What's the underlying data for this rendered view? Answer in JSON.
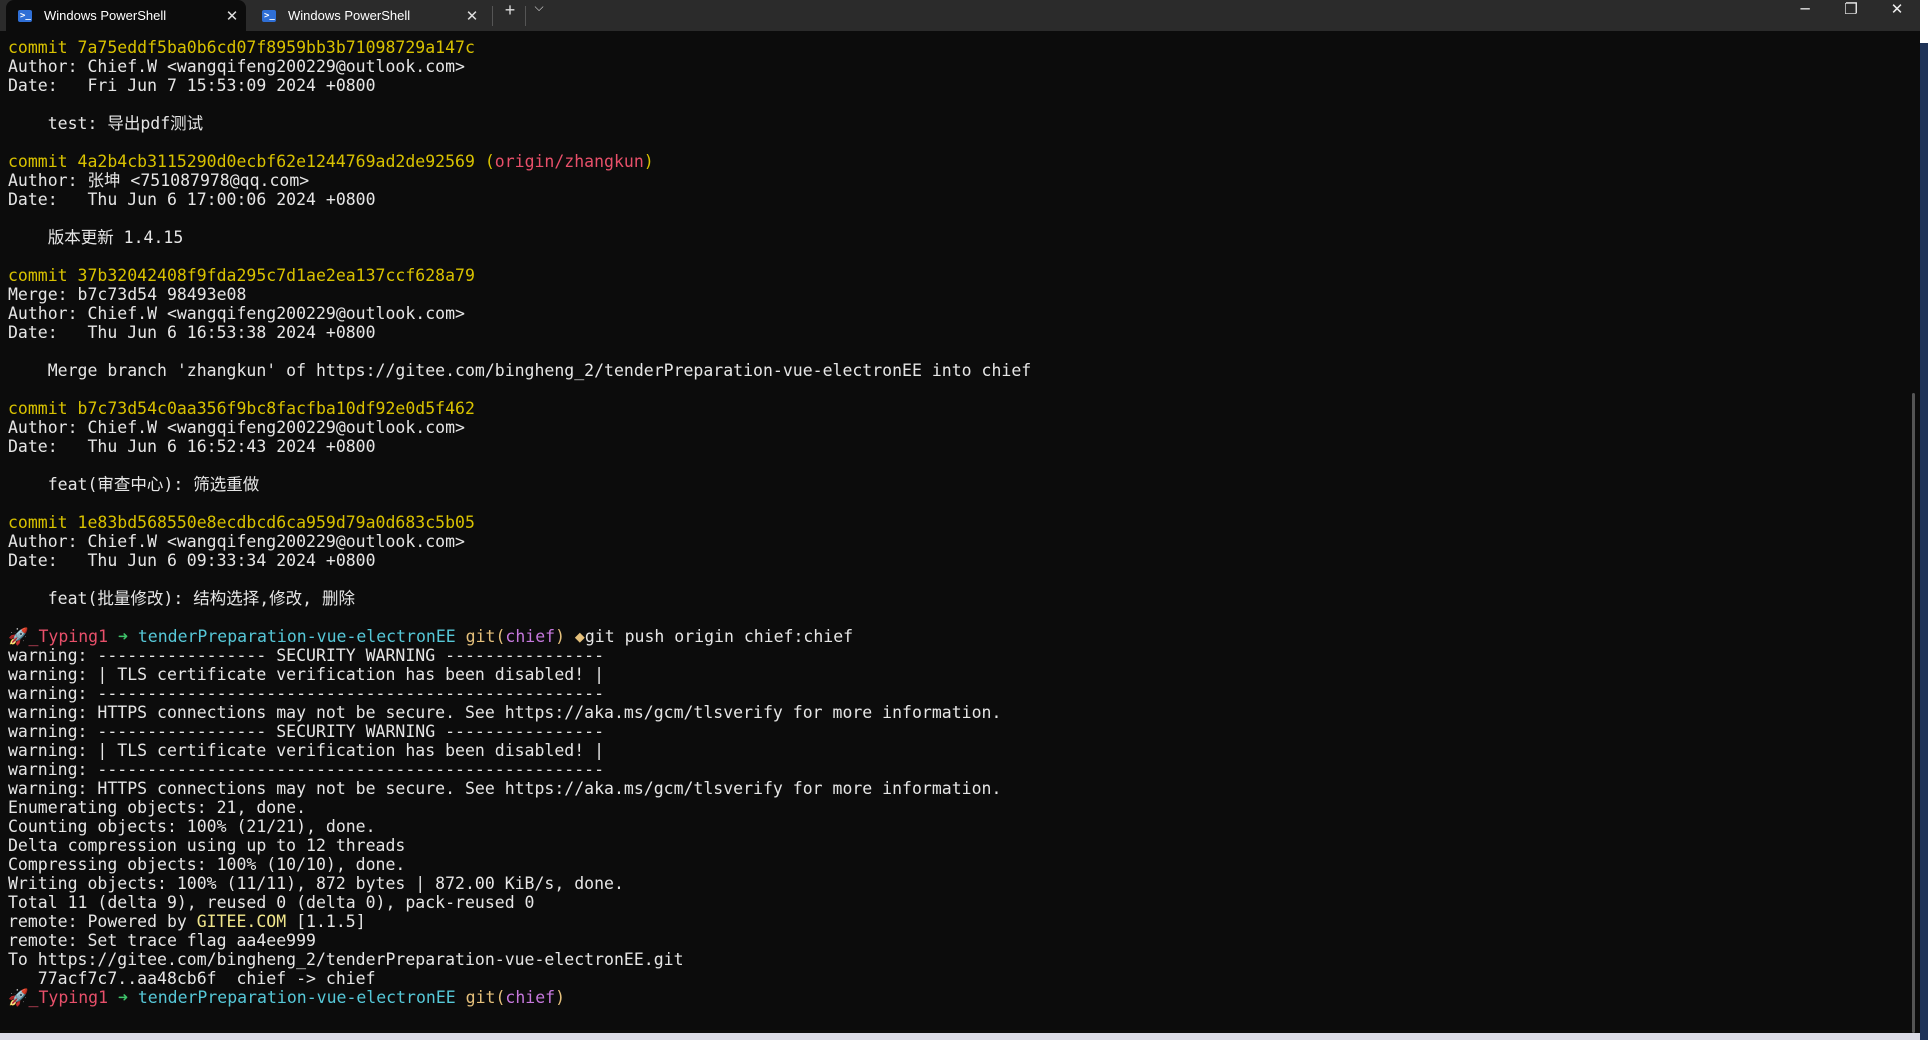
{
  "tabs": [
    {
      "label": "Windows PowerShell",
      "active": true
    },
    {
      "label": "Windows PowerShell",
      "active": false
    }
  ],
  "colors": {
    "commit": "#d9c200",
    "branch": "#e8506a",
    "text": "#e6e6e6",
    "cyan": "#56c8d8",
    "gitparen": "#e5c07b",
    "branchname": "#c678dd",
    "arrow": "#3fc56b",
    "gitee": "#f0e68c",
    "user": "#e8506a"
  },
  "lines": [
    [
      {
        "t": "commit 7a75eddf5ba0b6cd07f8959bb3b71098729a147c",
        "c": "commit"
      }
    ],
    [
      {
        "t": "Author: Chief.W <wangqifeng200229@outlook.com>"
      }
    ],
    [
      {
        "t": "Date:   Fri Jun 7 15:53:09 2024 +0800"
      }
    ],
    [],
    [
      {
        "t": "    test: 导出pdf测试"
      }
    ],
    [],
    [
      {
        "t": "commit 4a2b4cb3115290d0ecbf62e1244769ad2de92569 (",
        "c": "commit"
      },
      {
        "t": "origin/zhangkun",
        "c": "branch"
      },
      {
        "t": ")",
        "c": "commit"
      }
    ],
    [
      {
        "t": "Author: 张坤 <751087978@qq.com>"
      }
    ],
    [
      {
        "t": "Date:   Thu Jun 6 17:00:06 2024 +0800"
      }
    ],
    [],
    [
      {
        "t": "    版本更新 1.4.15"
      }
    ],
    [],
    [
      {
        "t": "commit 37b32042408f9fda295c7d1ae2ea137ccf628a79",
        "c": "commit"
      }
    ],
    [
      {
        "t": "Merge: b7c73d54 98493e08"
      }
    ],
    [
      {
        "t": "Author: Chief.W <wangqifeng200229@outlook.com>"
      }
    ],
    [
      {
        "t": "Date:   Thu Jun 6 16:53:38 2024 +0800"
      }
    ],
    [],
    [
      {
        "t": "    Merge branch 'zhangkun' of https://gitee.com/bingheng_2/tenderPreparation-vue-electronEE into chief"
      }
    ],
    [],
    [
      {
        "t": "commit b7c73d54c0aa356f9bc8facfba10df92e0d5f462",
        "c": "commit"
      }
    ],
    [
      {
        "t": "Author: Chief.W <wangqifeng200229@outlook.com>"
      }
    ],
    [
      {
        "t": "Date:   Thu Jun 6 16:52:43 2024 +0800"
      }
    ],
    [],
    [
      {
        "t": "    feat(审查中心): 筛选重做"
      }
    ],
    [],
    [
      {
        "t": "commit 1e83bd568550e8ecdbcd6ca959d79a0d683c5b05",
        "c": "commit"
      }
    ],
    [
      {
        "t": "Author: Chief.W <wangqifeng200229@outlook.com>"
      }
    ],
    [
      {
        "t": "Date:   Thu Jun 6 09:33:34 2024 +0800"
      }
    ],
    [],
    [
      {
        "t": "    feat(批量修改): 结构选择,修改, 删除"
      }
    ],
    [],
    [
      {
        "t": "🚀_Typing1",
        "c": "user"
      },
      {
        "t": " ➜ ",
        "c": "arrow"
      },
      {
        "t": "tenderPreparation-vue-electronEE",
        "c": "cyan"
      },
      {
        "t": " git(",
        "c": "gitparen"
      },
      {
        "t": "chief",
        "c": "branchname"
      },
      {
        "t": ")",
        "c": "gitparen"
      },
      {
        "t": " ◆",
        "c": "gitparen"
      },
      {
        "t": "git push origin chief:chief"
      }
    ],
    [
      {
        "t": "warning: ----------------- SECURITY WARNING ----------------"
      }
    ],
    [
      {
        "t": "warning: | TLS certificate verification has been disabled! |"
      }
    ],
    [
      {
        "t": "warning: ---------------------------------------------------"
      }
    ],
    [
      {
        "t": "warning: HTTPS connections may not be secure. See https://aka.ms/gcm/tlsverify for more information."
      }
    ],
    [
      {
        "t": "warning: ----------------- SECURITY WARNING ----------------"
      }
    ],
    [
      {
        "t": "warning: | TLS certificate verification has been disabled! |"
      }
    ],
    [
      {
        "t": "warning: ---------------------------------------------------"
      }
    ],
    [
      {
        "t": "warning: HTTPS connections may not be secure. See https://aka.ms/gcm/tlsverify for more information."
      }
    ],
    [
      {
        "t": "Enumerating objects: 21, done."
      }
    ],
    [
      {
        "t": "Counting objects: 100% (21/21), done."
      }
    ],
    [
      {
        "t": "Delta compression using up to 12 threads"
      }
    ],
    [
      {
        "t": "Compressing objects: 100% (10/10), done."
      }
    ],
    [
      {
        "t": "Writing objects: 100% (11/11), 872 bytes | 872.00 KiB/s, done."
      }
    ],
    [
      {
        "t": "Total 11 (delta 9), reused 0 (delta 0), pack-reused 0"
      }
    ],
    [
      {
        "t": "remote: Powered by "
      },
      {
        "t": "GITEE.COM",
        "c": "gitee"
      },
      {
        "t": " [1.1.5]"
      }
    ],
    [
      {
        "t": "remote: Set trace flag aa4ee999"
      }
    ],
    [
      {
        "t": "To https://gitee.com/bingheng_2/tenderPreparation-vue-electronEE.git"
      }
    ],
    [
      {
        "t": "   77acf7c7..aa48cb6f  chief -> chief"
      }
    ],
    [
      {
        "t": "🚀_Typing1",
        "c": "user"
      },
      {
        "t": " ➜ ",
        "c": "arrow"
      },
      {
        "t": "tenderPreparation-vue-electronEE",
        "c": "cyan"
      },
      {
        "t": " git(",
        "c": "gitparen"
      },
      {
        "t": "chief",
        "c": "branchname"
      },
      {
        "t": ")",
        "c": "gitparen"
      }
    ]
  ]
}
